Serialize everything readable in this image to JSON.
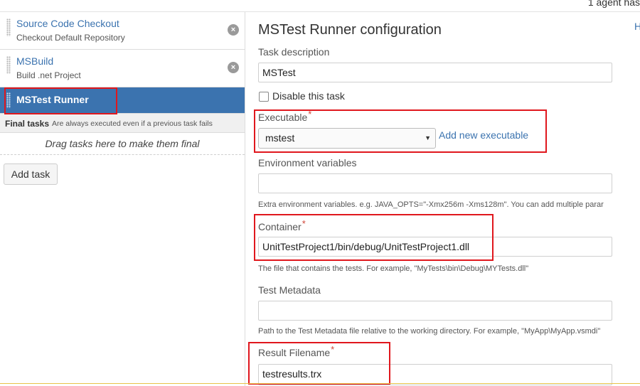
{
  "topbar": {
    "text": "1 agent has"
  },
  "tasks": [
    {
      "title": "Source Code Checkout",
      "subtitle": "Checkout Default Repository",
      "remove_icon": "×"
    },
    {
      "title": "MSBuild",
      "subtitle": "Build .net Project",
      "remove_icon": "×"
    },
    {
      "title": "MSTest Runner"
    }
  ],
  "final_tasks": {
    "title": "Final tasks",
    "description": "Are always executed even if a previous task fails",
    "drop_hint": "Drag tasks here to make them final"
  },
  "add_task_label": "Add task",
  "config": {
    "heading": "MSTest Runner configuration",
    "help_link": "H",
    "task_description": {
      "label": "Task description",
      "value": "MSTest"
    },
    "disable_task": {
      "label": "Disable this task",
      "checked": false
    },
    "executable": {
      "label": "Executable",
      "required_mark": "*",
      "selected": "mstest",
      "add_link": "Add new executable"
    },
    "env_vars": {
      "label": "Environment variables",
      "value": "",
      "help": "Extra environment variables. e.g. JAVA_OPTS=\"-Xmx256m -Xms128m\". You can add multiple parar"
    },
    "container": {
      "label": "Container",
      "required_mark": "*",
      "value": "UnitTestProject1/bin/debug/UnitTestProject1.dll",
      "help": "The file that contains the tests. For example, \"MyTests\\bin\\Debug\\MYTests.dll\""
    },
    "test_metadata": {
      "label": "Test Metadata",
      "value": "",
      "help": "Path to the Test Metadata file relative to the working directory. For example, \"MyApp\\MyApp.vsmdi\""
    },
    "result_filename": {
      "label": "Result Filename",
      "required_mark": "*",
      "value": "testresults.trx"
    }
  },
  "colors": {
    "link": "#3b73af",
    "active_task_bg": "#3b73af",
    "highlight": "#e0171d",
    "required": "#d04437"
  }
}
